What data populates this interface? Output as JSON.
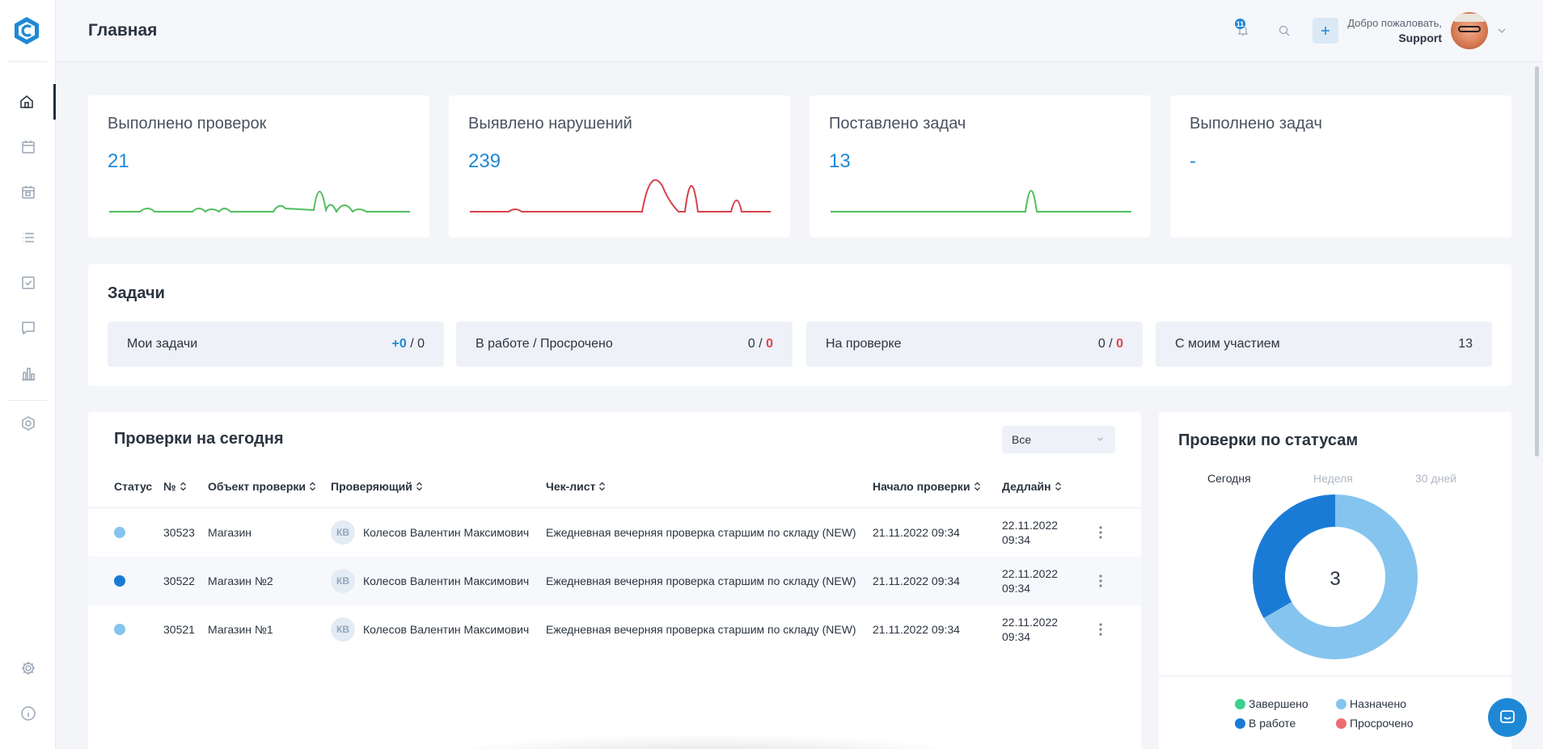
{
  "header": {
    "title": "Главная",
    "notifications_count": "11",
    "welcome_text": "Добро пожаловать,",
    "user_name": "Support"
  },
  "stats": [
    {
      "label": "Выполнено проверок",
      "value": "21",
      "color": "#4fbf5f"
    },
    {
      "label": "Выявлено нарушений",
      "value": "239",
      "color": "#d9414a"
    },
    {
      "label": "Поставлено задач",
      "value": "13",
      "color": "#4fbf5f"
    },
    {
      "label": "Выполнено задач",
      "value": "-",
      "color": "#4fbf5f"
    }
  ],
  "tasks": {
    "title": "Задачи",
    "items": [
      {
        "label": "Мои задачи",
        "a": "+0",
        "sep": " / ",
        "b": "0"
      },
      {
        "label": "В работе / Просрочено",
        "a": "0",
        "sep": " / ",
        "b": "0"
      },
      {
        "label": "На проверке",
        "a": "0",
        "sep": " / ",
        "b": "0"
      },
      {
        "label": "С моим участием",
        "a": "13",
        "sep": "",
        "b": ""
      }
    ]
  },
  "inspections": {
    "title": "Проверки на сегодня",
    "filter_value": "Все",
    "columns": {
      "status": "Статус",
      "number": "№",
      "object": "Объект проверки",
      "inspector": "Проверяющий",
      "checklist": "Чек-лист",
      "start": "Начало проверки",
      "deadline": "Дедлайн"
    },
    "rows": [
      {
        "status_color": "#85c4ee",
        "number": "30523",
        "object": "Магазин",
        "initials": "КВ",
        "inspector": "Колесов Валентин Максимович",
        "checklist": "Ежедневная вечерняя проверка старшим по складу (NEW)",
        "start": "21.11.2022 09:34",
        "deadline_date": "22.11.2022",
        "deadline_time": "09:34"
      },
      {
        "status_color": "#1a7bd6",
        "number": "30522",
        "object": "Магазин №2",
        "initials": "КВ",
        "inspector": "Колесов Валентин Максимович",
        "checklist": "Ежедневная вечерняя проверка старшим по складу (NEW)",
        "start": "21.11.2022 09:34",
        "deadline_date": "22.11.2022",
        "deadline_time": "09:34"
      },
      {
        "status_color": "#85c4ee",
        "number": "30521",
        "object": "Магазин №1",
        "initials": "КВ",
        "inspector": "Колесов Валентин Максимович",
        "checklist": "Ежедневная вечерняя проверка старшим по складу (NEW)",
        "start": "21.11.2022 09:34",
        "deadline_date": "22.11.2022",
        "deadline_time": "09:34"
      }
    ]
  },
  "status_card": {
    "title": "Проверки по статусам",
    "periods": [
      "Сегодня",
      "Неделя",
      "30 дней"
    ],
    "selected_period": "Сегодня",
    "total": "3",
    "legend": [
      {
        "label": "Завершено",
        "color": "#3ecf8e"
      },
      {
        "label": "Назначено",
        "color": "#85c4ee"
      },
      {
        "label": "В работе",
        "color": "#1a7bd6"
      },
      {
        "label": "Просрочено",
        "color": "#ef6b72"
      }
    ],
    "chart_data": {
      "type": "pie",
      "categories": [
        "Назначено",
        "В работе"
      ],
      "values": [
        2,
        1
      ],
      "colors": [
        "#85c4ee",
        "#1a7bd6"
      ]
    }
  }
}
